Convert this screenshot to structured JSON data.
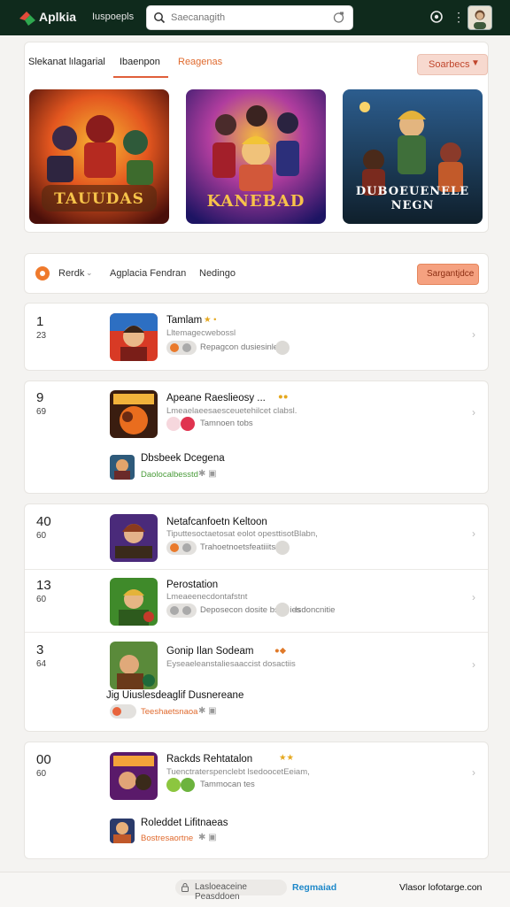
{
  "header": {
    "brand": "Aplkia",
    "nav": "Iuspoepls",
    "search_placeholder": "Saecanagith",
    "icons": [
      "logo-icon",
      "search-icon",
      "mic-icon",
      "settings-icon",
      "kebab-icon",
      "avatar"
    ]
  },
  "tabs": [
    {
      "label": "Slekanat lılagarial",
      "active": false
    },
    {
      "label": "Ibaenpon",
      "active": true
    },
    {
      "label": "Reagenas",
      "active": false,
      "accent": true
    }
  ],
  "sort_button": {
    "label": "Soarbecs"
  },
  "featured": [
    {
      "title": "TAUUDAS",
      "colors": [
        "#f07b27",
        "#7a1d0d"
      ]
    },
    {
      "title": "KANEBAD",
      "colors": [
        "#5b2fb0",
        "#1a1060"
      ]
    },
    {
      "title": "DUBOEUENELE NEGN",
      "colors": [
        "#1f4a7a",
        "#0c1f32"
      ]
    }
  ],
  "filter": {
    "dropdown": "Rerdk",
    "item1": "Agplacia Fendran",
    "item2": "Nedingo",
    "button": "Sargantjdce"
  },
  "list": [
    {
      "rank": "1",
      "sub": "23",
      "title": "Tamlam",
      "desc": "Lltemagecwebossl",
      "meta": "Repagcon dusiesinles"
    },
    {
      "rank": "9",
      "sub": "69",
      "title": "Apeane Raeslieosy ...",
      "desc": "Lmeaelaeesaesceuetehilcet clabsl.",
      "meta": "Tamnoen tobs"
    },
    {
      "title": "Dbsbeek Dcegena",
      "meta": "Daolocalbesstd"
    },
    {
      "rank": "40",
      "sub": "60",
      "title": "Netafcanfoetn Keltoon",
      "desc": "Tiputtesoctaetosat eolot opesttisotBlabn,",
      "meta": "Trahoetnoetsfeatiiits"
    },
    {
      "rank": "13",
      "sub": "60",
      "title": "Perostation",
      "desc": "Lmeaeenecdontafstnt",
      "meta": "Deposecon dosite bsleeies",
      "meta2": "Isdoncnitie"
    },
    {
      "rank": "3",
      "sub": "64",
      "title": "Gonip Ilan Sodeam",
      "desc": "Eyseaeleanstaliesaaccist dosactiis",
      "meta": "Teeshaetsnaoa"
    },
    {
      "title": "Jig Uiuslesdeaglif Dusnereane"
    },
    {
      "rank": "00",
      "sub": "60",
      "title": "Rackds Rehtatalon",
      "desc": "Tuenctraterspenclebt lsedoocetEeiam,",
      "meta": "Tammocan tes"
    },
    {
      "title": "Roleddet Lifitnaeas",
      "meta": "Bostresaortne"
    }
  ],
  "footer": {
    "pill": "Lasloeaceine Peasddoen",
    "link": "Regmaiad",
    "right": "Vlasor lofotarge.con"
  }
}
